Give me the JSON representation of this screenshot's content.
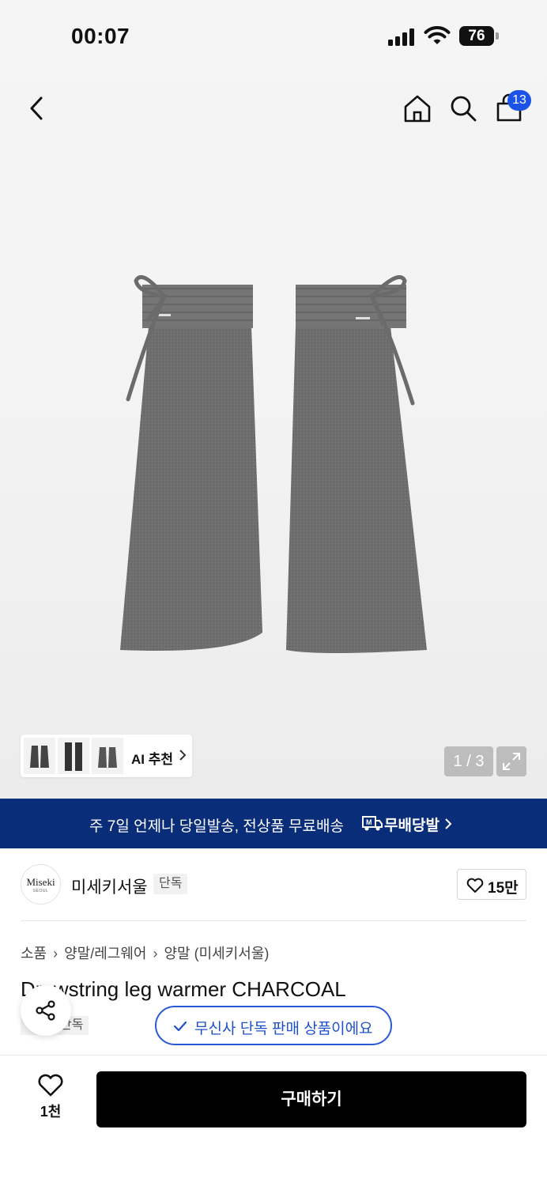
{
  "status_bar": {
    "time": "00:07",
    "battery": "76"
  },
  "nav": {
    "cart_count": "13",
    "icons": [
      "back-icon",
      "home-icon",
      "search-icon",
      "cart-icon"
    ]
  },
  "gallery": {
    "ai_label": "AI 추천",
    "counter": "1 / 3",
    "product_color": "#6f6f6f"
  },
  "banner": {
    "text": "주 7일 언제나 당일발송, 전상품 무료배송",
    "brand": "무배당발",
    "background": "#0a2d7a"
  },
  "brand": {
    "logo_text": "Miseki",
    "logo_sub": "SEOUL",
    "name": "미세키서울",
    "tag": "단독",
    "likes": "15만"
  },
  "breadcrumb": [
    "소품",
    "양말/레그웨어",
    "양말 (미세키서울)"
  ],
  "product": {
    "title": "Drawstring leg warmer CHARCOAL",
    "tag": "단독"
  },
  "tooltip": {
    "text": "무신사 단독 판매 상품이에요",
    "color": "#2a5ad8"
  },
  "bottom_bar": {
    "wish_count": "1천",
    "buy_label": "구매하기"
  }
}
